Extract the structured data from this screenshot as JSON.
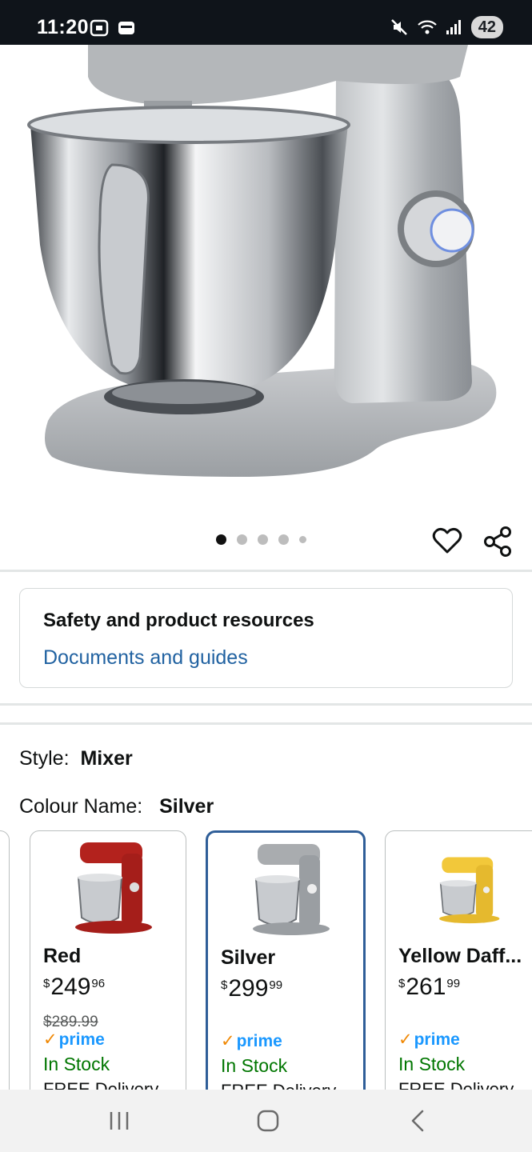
{
  "status_bar": {
    "time": "11:20",
    "battery": "42",
    "left_icons": [
      "screenshot-icon",
      "message-icon"
    ],
    "right_icons": [
      "mute-icon",
      "wifi-icon",
      "signal-icon"
    ]
  },
  "gallery": {
    "image_alt": "Silver stand mixer",
    "dot_count": 5,
    "active_dot": 0
  },
  "resources": {
    "title": "Safety and product resources",
    "link": "Documents and guides"
  },
  "style": {
    "label": "Style:",
    "value": "Mixer"
  },
  "colour": {
    "label": "Colour Name:",
    "value": "Silver"
  },
  "swatches": [
    {
      "name": "Red",
      "cur": "$",
      "dollars": "249",
      "cents": "96",
      "strike": "$289.99",
      "prime": "prime",
      "stock": "In Stock",
      "delivery": "FREE Delivery",
      "color": "#b3221d"
    },
    {
      "name": "Silver",
      "cur": "$",
      "dollars": "299",
      "cents": "99",
      "prime": "prime",
      "stock": "In Stock",
      "delivery": "FREE Delivery",
      "color": "#a9acaf"
    },
    {
      "name": "Yellow Daff...",
      "cur": "$",
      "dollars": "261",
      "cents": "99",
      "prime": "prime",
      "stock": "In Stock",
      "delivery": "FREE Delivery",
      "color": "#f2c83a"
    }
  ],
  "colors": {
    "link": "#2162a1",
    "in_stock": "#007600",
    "prime_blue": "#1a98ff",
    "prime_check": "#f08804",
    "selected_border": "#2f5e98"
  }
}
